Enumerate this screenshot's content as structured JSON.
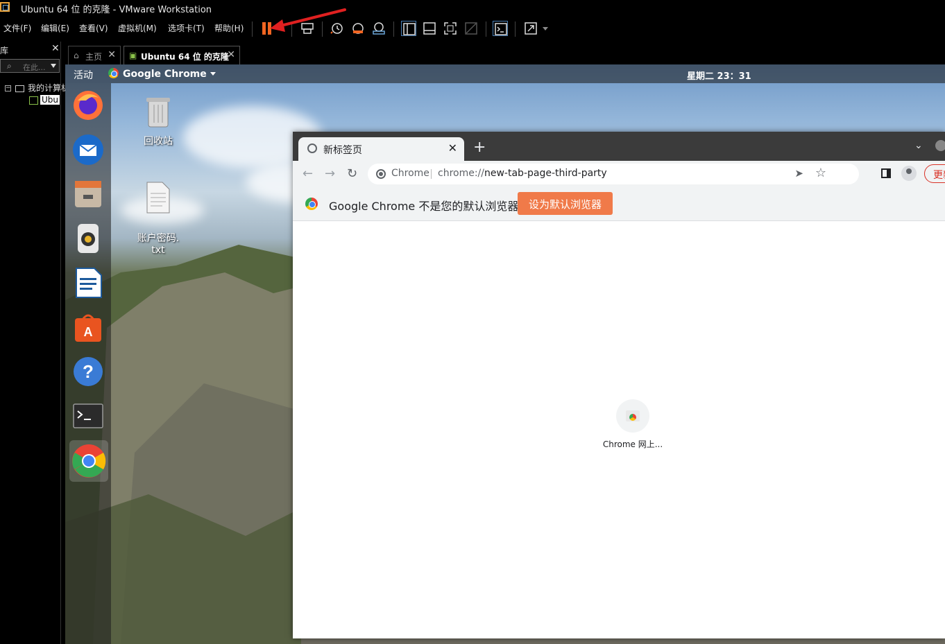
{
  "window": {
    "title": "Ubuntu 64 位 的克隆 - VMware Workstation"
  },
  "menubar": {
    "items": [
      "文件(F)",
      "编辑(E)",
      "查看(V)",
      "虚拟机(M)",
      "选项卡(T)",
      "帮助(H)"
    ]
  },
  "toolbar": {
    "icons": [
      "pause-icon",
      "send-ctrl-alt-del-icon",
      "snapshot-icon",
      "revert-snapshot-icon",
      "snapshot-manager-icon",
      "normal-view-icon",
      "thumbnail-view-icon",
      "full-screen-icon",
      "unity-icon",
      "console-view-icon",
      "stretch-icon"
    ],
    "accent_color": "#f26522"
  },
  "library": {
    "title": "库",
    "search_placeholder": "在此...",
    "tree": {
      "root": "我的计算机",
      "vm": "Ubu"
    }
  },
  "tabs": {
    "home": "主页",
    "vm": "Ubuntu 64 位 的克隆"
  },
  "guest": {
    "topbar": {
      "activities": "活动",
      "app_menu": "Google Chrome",
      "clock": "星期二 23：31"
    },
    "dock": [
      "firefox-icon",
      "thunderbird-icon",
      "files-icon",
      "rhythmbox-icon",
      "libreoffice-writer-icon",
      "software-center-icon",
      "help-icon",
      "terminal-icon",
      "chrome-icon"
    ],
    "desktop_icons": {
      "trash": "回收站",
      "file": "账户密码.\ntxt"
    }
  },
  "chrome": {
    "tab_title": "新标签页",
    "omnibox": {
      "chip": "Chrome",
      "url_scheme": "chrome://",
      "url_rest": "new-tab-page-third-party"
    },
    "update_button": "更新",
    "infobar": {
      "message": "Google Chrome 不是您的默认浏览器",
      "button": "设为默认浏览器",
      "button_color": "#f07a49"
    },
    "shortcut": {
      "label": "Chrome 网上..."
    }
  }
}
